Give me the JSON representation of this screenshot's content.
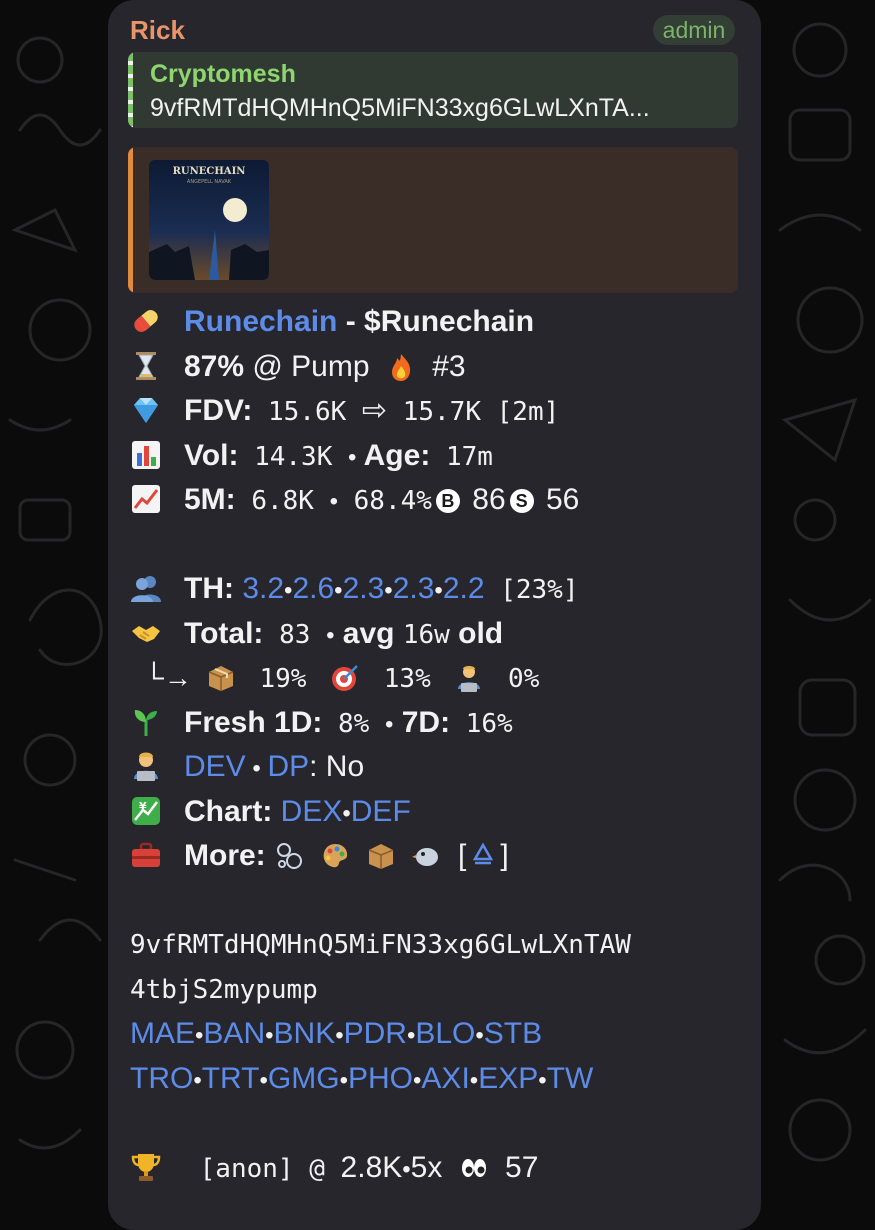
{
  "message": {
    "sender": "Rick",
    "badge": "admin",
    "reply": {
      "title": "Cryptomesh",
      "text": "9vfRMTdHQMHnQ5MiFN33xg6GLwLXnTA..."
    },
    "thumbnail": {
      "title": "RUNECHAIN",
      "subtitle": "ANGEPELL NAVAK"
    },
    "token": {
      "name": "Runechain",
      "sep": " - ",
      "ticker": "$Runechain",
      "icon": "pill-icon"
    },
    "progress": {
      "percent": "87%",
      "text": " @ Pump ",
      "rank": " #3",
      "icon": "hourglass-icon"
    },
    "fdv": {
      "label": "FDV:",
      "from": " 15.6K ",
      "arrow": "⇨",
      "to": " 15.7K [2m]",
      "icon": "gem-icon"
    },
    "vol": {
      "label": "Vol:",
      "value": " 14.3K ",
      "sep": "•",
      "age_label": " Age:",
      "age_value": " 17m",
      "icon": "bar-chart-icon"
    },
    "five_m": {
      "label": "5M:",
      "value": " 6.8K ",
      "sep": "•",
      "pct": " 68.4%",
      "buy_glyph": "B",
      "buys": " 86",
      "sell_glyph": "S",
      "sells": " 56",
      "icon": "chart-increasing-icon"
    },
    "th": {
      "label": "TH:",
      "values": [
        "3.2",
        "2.6",
        "2.3",
        "2.3",
        "2.2"
      ],
      "sep": "•",
      "total": " [23%]",
      "icon": "busts-icon"
    },
    "total": {
      "label": "Total:",
      "value": " 83 ",
      "sep": "•",
      "avg_label": " avg ",
      "avg_value": "16w",
      "old_label": " old",
      "icon": "handshake-icon"
    },
    "breakdown": {
      "hook": "└→",
      "a": " 19% ",
      "b": " 13% ",
      "c": " 0%",
      "icons": [
        "package-icon",
        "target-icon",
        "technologist-icon"
      ]
    },
    "fresh": {
      "label": "Fresh 1D:",
      "value": " 8% ",
      "sep": "•",
      "label2": " 7D:",
      "value2": " 16%",
      "icon": "seedling-icon"
    },
    "dev": {
      "link1": "DEV",
      "sep": " • ",
      "link2": "DP",
      "label": ": No",
      "icon": "technologist-icon"
    },
    "chart": {
      "label": "Chart: ",
      "links": [
        "DEX",
        "DEF"
      ],
      "sep": "•",
      "icon": "chart-yen-icon"
    },
    "more": {
      "label": "More:",
      "icons": [
        "bubbles-icon",
        "palette-icon",
        "package-icon",
        "bird-icon"
      ],
      "recycle_open": " [",
      "recycle_close": "]",
      "icon": "toolbox-icon"
    },
    "address": {
      "line1": "9vfRMTdHQMHnQ5MiFN33xg6GLwLXnTAW",
      "line2": "4tbjS2mypump"
    },
    "links_row1": [
      "MAE",
      "BAN",
      "BNK",
      "PDR",
      "BLO",
      "STB"
    ],
    "links_row2": [
      "TRO",
      "TRT",
      "GMG",
      "PHO",
      "AXI",
      "EXP",
      "TW"
    ],
    "link_sep": "•",
    "trophy": {
      "label": " [anon] @ ",
      "value": "2.8K",
      "sep": "•",
      "mult": "5x ",
      "views": " 57",
      "icon": "trophy-icon"
    }
  },
  "colors": {
    "sender": "#e8956a",
    "link": "#5c8ce8",
    "reply_title": "#8ed46f",
    "bubble": "#27262d"
  }
}
